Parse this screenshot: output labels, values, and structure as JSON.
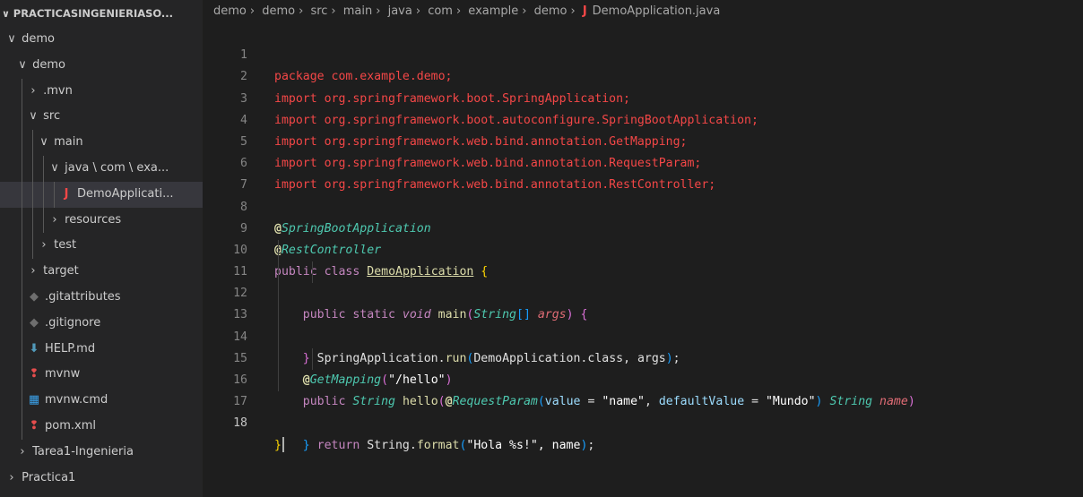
{
  "explorer": {
    "root": "PRACTICASINGENIERIASO...",
    "items": [
      {
        "label": "demo",
        "twisty": "∨",
        "icon": "",
        "depth": 0
      },
      {
        "label": "demo",
        "twisty": "∨",
        "icon": "",
        "depth": 1
      },
      {
        "label": ".mvn",
        "twisty": "›",
        "icon": "",
        "depth": 2
      },
      {
        "label": "src",
        "twisty": "∨",
        "icon": "",
        "depth": 2
      },
      {
        "label": "main",
        "twisty": "∨",
        "icon": "",
        "depth": 3
      },
      {
        "label": "java \\ com \\ exa...",
        "twisty": "∨",
        "icon": "",
        "depth": 4
      },
      {
        "label": "DemoApplicati...",
        "twisty": "",
        "icon": "java-file-icon",
        "depth": 5
      },
      {
        "label": "resources",
        "twisty": "›",
        "icon": "",
        "depth": 4
      },
      {
        "label": "test",
        "twisty": "›",
        "icon": "",
        "depth": 3
      },
      {
        "label": "target",
        "twisty": "›",
        "icon": "",
        "depth": 2
      },
      {
        "label": ".gitattributes",
        "twisty": "",
        "icon": "git-icon",
        "depth": 2
      },
      {
        "label": ".gitignore",
        "twisty": "",
        "icon": "git-icon",
        "depth": 2
      },
      {
        "label": "HELP.md",
        "twisty": "",
        "icon": "markdown-icon",
        "depth": 2
      },
      {
        "label": "mvnw",
        "twisty": "",
        "icon": "maven-icon",
        "depth": 2
      },
      {
        "label": "mvnw.cmd",
        "twisty": "",
        "icon": "windows-icon",
        "depth": 2
      },
      {
        "label": "pom.xml",
        "twisty": "",
        "icon": "maven-icon",
        "depth": 2
      },
      {
        "label": "Tarea1-Ingenieria",
        "twisty": "›",
        "icon": "",
        "depth": 1
      },
      {
        "label": "Practica1",
        "twisty": "›",
        "icon": "",
        "depth": 0
      }
    ]
  },
  "breadcrumb": {
    "parts": [
      "demo",
      "demo",
      "src",
      "main",
      "java",
      "com",
      "example",
      "demo"
    ],
    "file": "DemoApplication.java",
    "file_icon": "java-file-icon"
  },
  "editor": {
    "line_numbers": [
      "1",
      "2",
      "3",
      "4",
      "5",
      "6",
      "7",
      "8",
      "9",
      "10",
      "11",
      "12",
      "13",
      "14",
      "15",
      "16",
      "17",
      "18"
    ],
    "active_line": "18",
    "lines": [
      "package com.example.demo;",
      "import org.springframework.boot.SpringApplication;",
      "import org.springframework.boot.autoconfigure.SpringBootApplication;",
      "import org.springframework.web.bind.annotation.GetMapping;",
      "import org.springframework.web.bind.annotation.RequestParam;",
      "import org.springframework.web.bind.annotation.RestController;",
      "",
      "@SpringBootApplication",
      "@RestController",
      "public class DemoApplication {",
      "    public static void main(String[] args) {",
      "      SpringApplication.run(DemoApplication.class, args);",
      "    }",
      "    @GetMapping(\"/hello\")",
      "    public String hello(@RequestParam(value = \"name\", defaultValue = \"Mundo\") String name)",
      "      return String.format(\"Hola %s!\", name);",
      "    }",
      "}"
    ]
  },
  "colors": {
    "sidebar_bg": "#252526",
    "editor_bg": "#1e1e1e",
    "import_red": "#f44747",
    "keyword": "#c586c0",
    "annotation": "#4ec9b0"
  }
}
